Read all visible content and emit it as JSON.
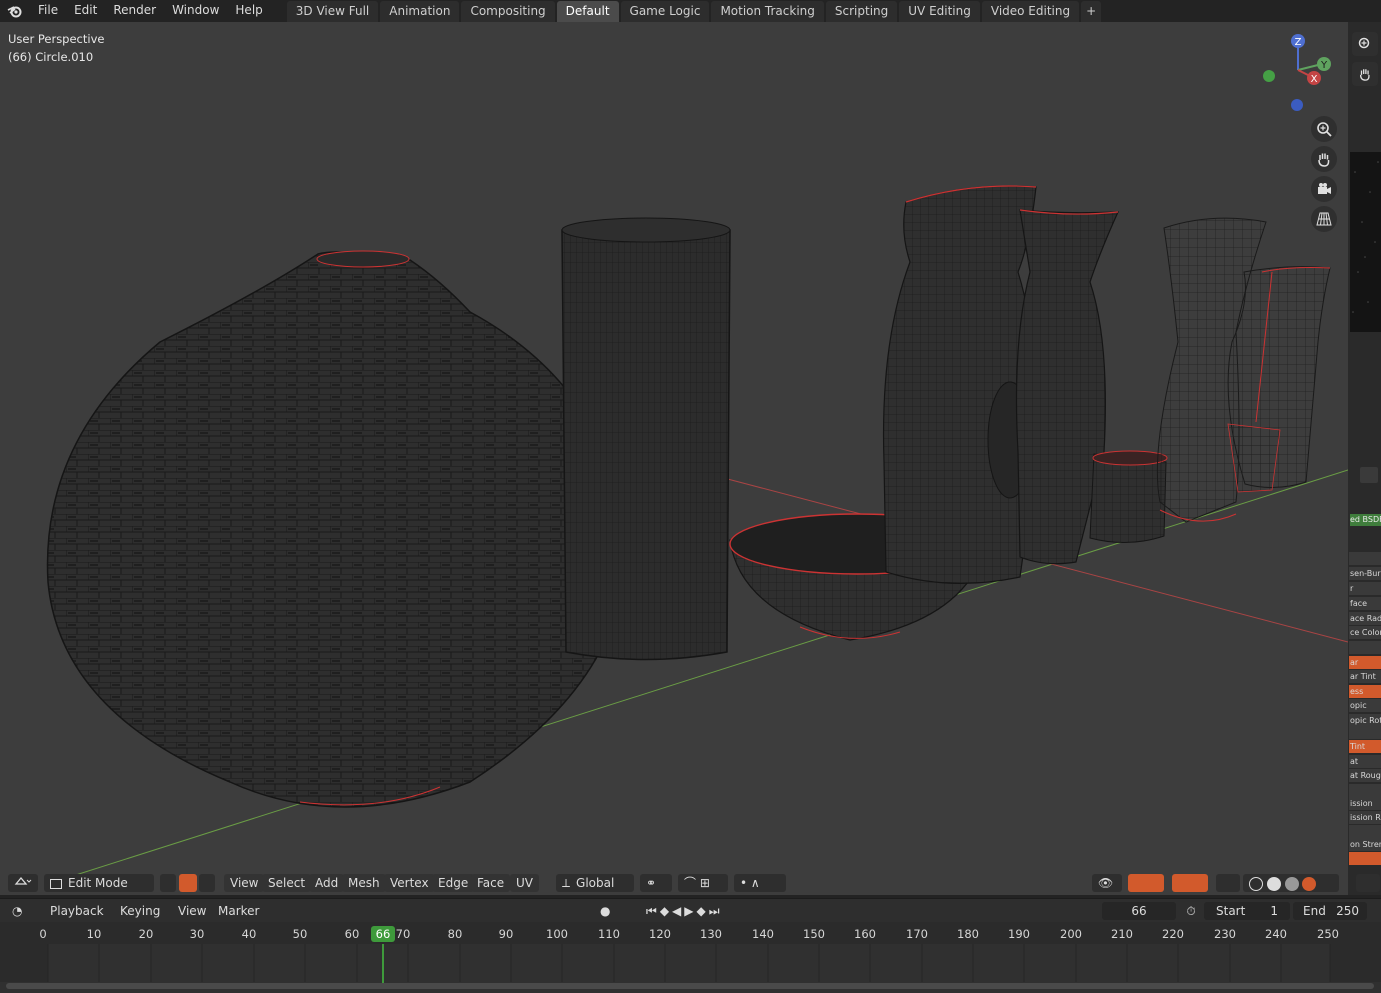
{
  "menu": {
    "file": "File",
    "edit": "Edit",
    "render": "Render",
    "window": "Window",
    "help": "Help"
  },
  "workspaces": [
    {
      "label": "3D View Full",
      "active": false
    },
    {
      "label": "Animation",
      "active": false
    },
    {
      "label": "Compositing",
      "active": false
    },
    {
      "label": "Default",
      "active": true
    },
    {
      "label": "Game Logic",
      "active": false
    },
    {
      "label": "Motion Tracking",
      "active": false
    },
    {
      "label": "Scripting",
      "active": false
    },
    {
      "label": "UV Editing",
      "active": false
    },
    {
      "label": "Video Editing",
      "active": false
    }
  ],
  "add_workspace": "+",
  "viewport": {
    "view_name": "User Perspective",
    "object_info": "(66) Circle.010",
    "gizmo": {
      "z": "Z",
      "y": "Y",
      "x": "X"
    }
  },
  "header": {
    "mode": "Edit Mode",
    "view": "View",
    "select": "Select",
    "add": "Add",
    "mesh": "Mesh",
    "vertex": "Vertex",
    "edge": "Edge",
    "face": "Face",
    "uv": "UV",
    "orientation": "Global"
  },
  "side_panel": {
    "rows": [
      {
        "text": "ed BSDF",
        "style": "green"
      },
      {
        "text": "",
        "style": "normal"
      },
      {
        "text": "sen-Burl",
        "style": "normal"
      },
      {
        "text": "r",
        "style": "normal"
      },
      {
        "text": "face",
        "style": "normal"
      },
      {
        "text": "ace Radiu",
        "style": "normal"
      },
      {
        "text": "ce Color",
        "style": "normal"
      },
      {
        "text": "",
        "style": "normal"
      },
      {
        "text": "ar",
        "style": "orange"
      },
      {
        "text": "ar Tint",
        "style": "normal"
      },
      {
        "text": "ess",
        "style": "orange"
      },
      {
        "text": "opic",
        "style": "normal"
      },
      {
        "text": "opic Rot",
        "style": "normal"
      },
      {
        "text": "",
        "style": "normal"
      },
      {
        "text": "Tint",
        "style": "orange"
      },
      {
        "text": "at",
        "style": "normal"
      },
      {
        "text": "at Rough",
        "style": "normal"
      },
      {
        "text": "",
        "style": "normal"
      },
      {
        "text": "ission",
        "style": "normal"
      },
      {
        "text": "ission Re",
        "style": "normal"
      },
      {
        "text": "",
        "style": "normal"
      },
      {
        "text": "on Stren",
        "style": "normal"
      },
      {
        "text": "",
        "style": "orange"
      }
    ]
  },
  "timeline": {
    "playback": "Playback",
    "keying": "Keying",
    "view": "View",
    "marker": "Marker",
    "current_frame": "66",
    "start_label": "Start",
    "start_value": "1",
    "end_label": "End",
    "end_value": "250",
    "ruler": [
      "0",
      "10",
      "20",
      "30",
      "40",
      "50",
      "60",
      "70",
      "80",
      "90",
      "100",
      "110",
      "120",
      "130",
      "140",
      "150",
      "160",
      "170",
      "180",
      "190",
      "200",
      "210",
      "220",
      "230",
      "240",
      "250"
    ],
    "playhead": "66"
  }
}
